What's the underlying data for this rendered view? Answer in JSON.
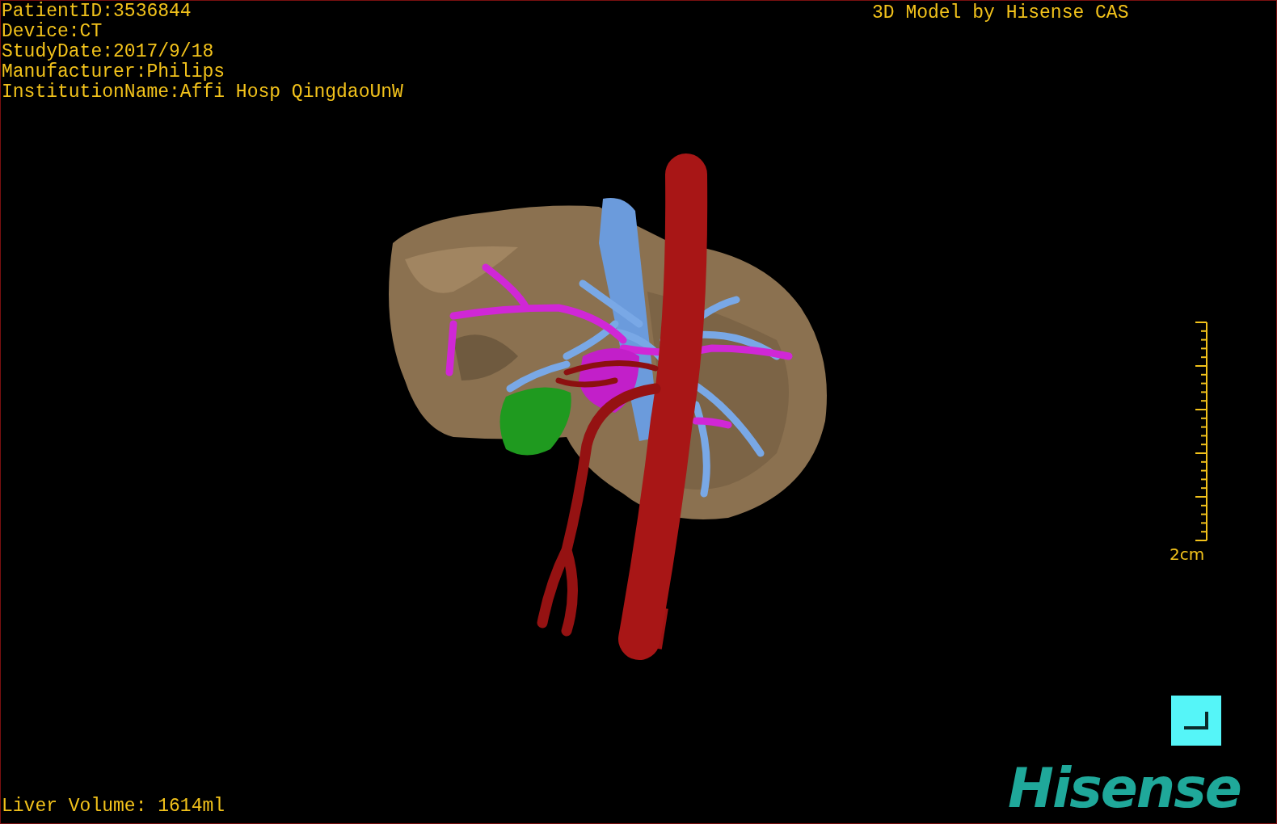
{
  "info_lines": [
    "PatientID:3536844",
    "Device:CT",
    "StudyDate:2017/9/18",
    "Manufacturer:Philips",
    "InstitutionName:Affi Hosp QingdaoUnW"
  ],
  "title": "3D Model by Hisense CAS",
  "scale_bar": {
    "label": "2cm"
  },
  "liver_volume": "Liver Volume: 1614ml",
  "logo": "Hisense"
}
